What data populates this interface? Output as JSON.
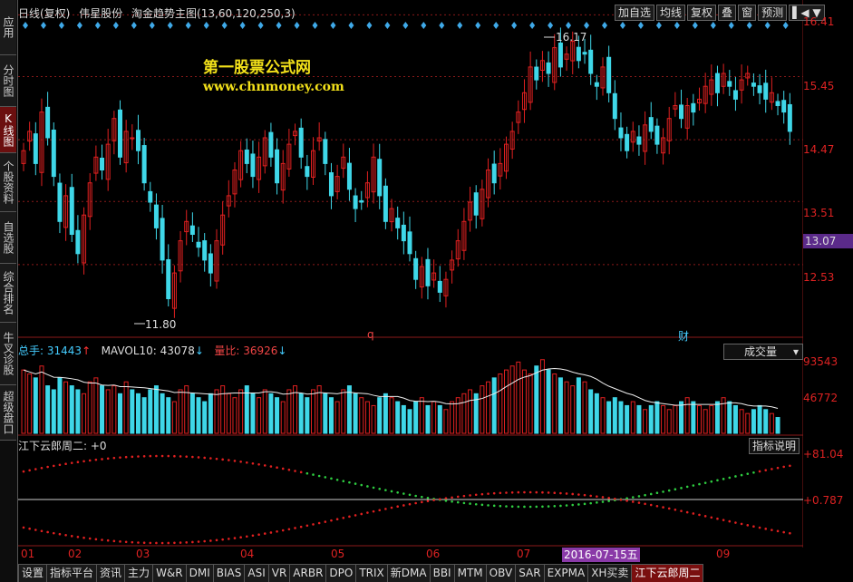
{
  "title": {
    "period": "日线(复权)",
    "stock_name": "伟星股份",
    "formula": "淘金趋势主图(13,60,120,250,3)"
  },
  "toolbar": [
    "加自选",
    "均线",
    "复权",
    "叠",
    "窗",
    "预测"
  ],
  "sidebar": [
    "应用",
    "分时图",
    "K线图",
    "个股资料",
    "自选股",
    "综合排名",
    "牛叉诊股",
    "超级盘口"
  ],
  "watermark": {
    "line1": "第一股票公式网",
    "line2": "www.chnmoney.com"
  },
  "price_axis": [
    "16.41",
    "15.45",
    "14.47",
    "13.51",
    "12.53"
  ],
  "current_price": "13.07",
  "annotations": {
    "high": "16.17",
    "low": "11.80",
    "q_marker": "q",
    "cai_marker": "财"
  },
  "volume": {
    "hands_label": "总手:",
    "hands_value": "31443",
    "mavol_label": "MAVOL10:",
    "mavol_value": "43078",
    "ratio_label": "量比:",
    "ratio_value": "36926",
    "dropdown": "成交量",
    "axis": [
      "93543",
      "46772"
    ]
  },
  "indicator": {
    "title": "江下云郎周二: +0",
    "explain_button": "指标说明",
    "axis": [
      "+81.04",
      "+0.787"
    ]
  },
  "date_axis": [
    "01",
    "02",
    "03",
    "04",
    "05",
    "06",
    "07",
    "08",
    "09"
  ],
  "date_badge": "2016-07-15五",
  "bottom_tabs": [
    "设置",
    "指标平台",
    "资讯",
    "主力",
    "W&R",
    "DMI",
    "BIAS",
    "ASI",
    "VR",
    "ARBR",
    "DPO",
    "TRIX",
    "新DMA",
    "BBI",
    "MTM",
    "OBV",
    "SAR",
    "EXPMA",
    "XH买卖",
    "江下云郎周二"
  ],
  "colors": {
    "up": "#e02020",
    "down": "#3fd7e8",
    "accent_yellow": "#f3e11a",
    "grid": "#8b1a1a"
  },
  "chart_data": {
    "type": "candlestick",
    "ylim": [
      11.5,
      16.5
    ],
    "y_ticks": [
      16.41,
      15.45,
      14.47,
      13.51,
      12.53
    ],
    "high_mark": 16.17,
    "low_mark": 11.8,
    "closes": [
      14.3,
      14.6,
      14.1,
      14.9,
      14.5,
      13.9,
      13.2,
      13.6,
      13.0,
      12.7,
      13.3,
      13.8,
      14.2,
      14.0,
      14.4,
      14.8,
      14.2,
      14.6,
      14.5,
      14.3,
      13.8,
      13.5,
      13.1,
      12.6,
      12.0,
      12.4,
      12.9,
      13.2,
      13.0,
      12.8,
      12.6,
      12.4,
      12.9,
      13.3,
      13.6,
      14.0,
      14.3,
      14.1,
      13.9,
      14.2,
      14.5,
      14.2,
      13.8,
      14.1,
      14.4,
      14.6,
      14.2,
      13.9,
      14.3,
      14.5,
      14.1,
      13.6,
      13.9,
      14.2,
      13.7,
      13.4,
      13.5,
      13.8,
      14.2,
      13.6,
      13.2,
      13.4,
      13.1,
      12.9,
      12.7,
      12.3,
      12.5,
      12.2,
      12.4,
      12.1,
      12.3,
      12.6,
      12.9,
      13.2,
      13.5,
      13.3,
      13.7,
      14.0,
      13.8,
      14.1,
      14.4,
      14.6,
      14.9,
      15.2,
      15.6,
      15.4,
      15.7,
      15.5,
      15.9,
      15.6,
      15.8,
      16.0,
      15.7,
      15.8,
      15.5,
      15.3,
      15.6,
      15.2,
      14.8,
      14.5,
      14.3,
      14.6,
      14.4,
      14.7,
      14.6,
      14.4,
      14.5,
      14.8,
      15.0,
      14.8,
      15.0,
      14.9,
      15.1,
      15.3,
      15.4,
      15.2,
      15.5,
      15.3,
      15.1,
      15.4,
      15.5,
      15.3,
      15.2,
      15.1,
      15.2,
      15.0,
      14.9,
      14.6
    ],
    "volumes": [
      80,
      75,
      70,
      85,
      60,
      55,
      70,
      65,
      60,
      55,
      50,
      65,
      70,
      60,
      55,
      60,
      50,
      65,
      55,
      50,
      45,
      55,
      60,
      50,
      45,
      40,
      55,
      60,
      50,
      45,
      40,
      50,
      55,
      60,
      50,
      45,
      55,
      60,
      50,
      45,
      55,
      50,
      45,
      40,
      55,
      60,
      50,
      45,
      55,
      60,
      50,
      45,
      40,
      55,
      60,
      50,
      45,
      40,
      35,
      45,
      50,
      45,
      40,
      35,
      30,
      40,
      45,
      35,
      40,
      35,
      30,
      40,
      45,
      50,
      55,
      50,
      60,
      65,
      70,
      75,
      80,
      85,
      90,
      80,
      75,
      85,
      93,
      80,
      75,
      70,
      65,
      60,
      70,
      65,
      55,
      50,
      45,
      40,
      45,
      40,
      35,
      40,
      35,
      30,
      35,
      40,
      35,
      30,
      35,
      40,
      45,
      40,
      35,
      30,
      35,
      40,
      45,
      40,
      35,
      30,
      25,
      30,
      35,
      30,
      25,
      20
    ]
  }
}
